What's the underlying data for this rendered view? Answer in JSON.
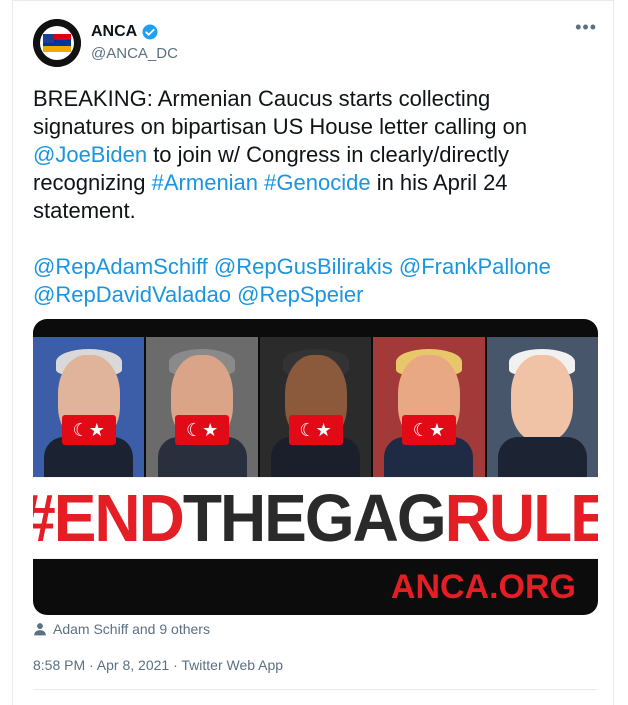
{
  "account": {
    "display_name": "ANCA",
    "handle": "@ANCA_DC",
    "verified": true
  },
  "tweet": {
    "part1": "BREAKING: Armenian Caucus starts collecting signatures on bipartisan US House letter calling on ",
    "mention_biden": "@JoeBiden",
    "part2": " to join w/ Congress in clearly/directly recognizing ",
    "hashtag_armenian": "#Armenian",
    "space": " ",
    "hashtag_genocide": "#Genocide",
    "part3": " in his April 24 statement.",
    "mentions": [
      "@RepAdamSchiff",
      "@RepGusBilirakis",
      "@FrankPallone",
      "@RepDavidValadao",
      "@RepSpeier"
    ]
  },
  "media": {
    "banner_dark_1": "#END",
    "banner_red": "THEGAG",
    "banner_dark_2": "RULE",
    "site": "ANCA.ORG",
    "face_count": 5
  },
  "likers": {
    "text": "Adam Schiff and 9 others"
  },
  "meta": {
    "text": "8:58 PM · Apr 8, 2021 · Twitter Web App"
  },
  "colors": {
    "link": "#1b95e0",
    "brand_red": "#e31e24",
    "muted": "#5b7083"
  },
  "icons": {
    "more": "more-options-icon",
    "verified": "verified-badge-icon",
    "person": "person-icon"
  }
}
